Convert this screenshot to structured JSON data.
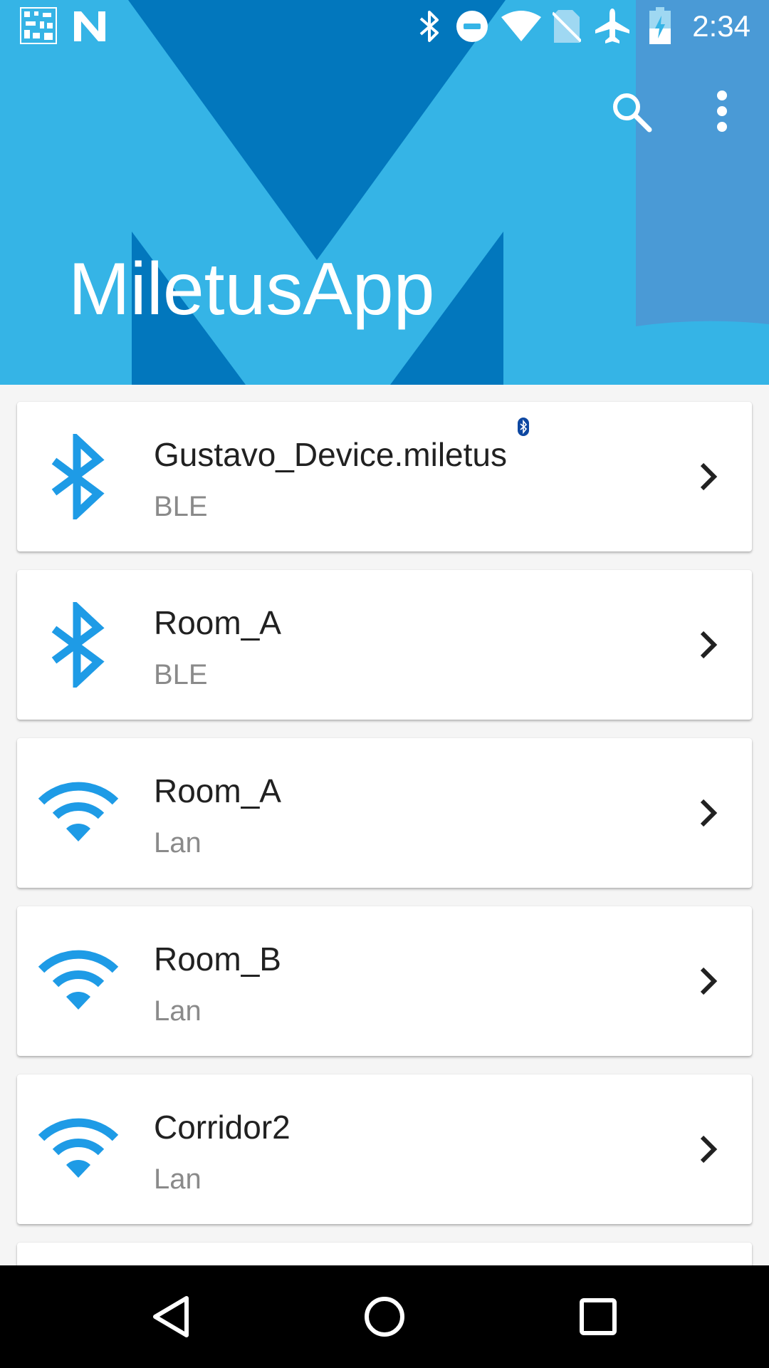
{
  "status_bar": {
    "time": "2:34",
    "left_icons": [
      "qr-code-icon",
      "n-logo-icon"
    ],
    "right_icons": [
      "bluetooth-icon",
      "do-not-disturb-icon",
      "wifi-icon",
      "no-sim-icon",
      "airplane-mode-icon",
      "battery-charging-icon"
    ]
  },
  "header": {
    "title": "MiletusApp",
    "actions": [
      "search-icon",
      "more-vert-icon"
    ],
    "colors": {
      "background": "#35b4e6",
      "logo_shape": "#0277bd",
      "accent_stripe": "#4a9ad6"
    }
  },
  "devices": [
    {
      "name": "Gustavo_Device.miletus",
      "type": "BLE",
      "icon": "bluetooth-icon",
      "badge_icon": "small-bluetooth-badge-icon"
    },
    {
      "name": "Room_A",
      "type": "BLE",
      "icon": "bluetooth-icon"
    },
    {
      "name": "Room_A",
      "type": "Lan",
      "icon": "wifi-icon"
    },
    {
      "name": "Room_B",
      "type": "Lan",
      "icon": "wifi-icon"
    },
    {
      "name": "Corridor2",
      "type": "Lan",
      "icon": "wifi-icon"
    }
  ],
  "nav_bar": {
    "buttons": [
      "back-icon",
      "home-icon",
      "recents-icon"
    ]
  },
  "colors": {
    "icon_blue": "#1e9be6",
    "text_primary": "#212121",
    "text_secondary": "#8a8a8a"
  }
}
